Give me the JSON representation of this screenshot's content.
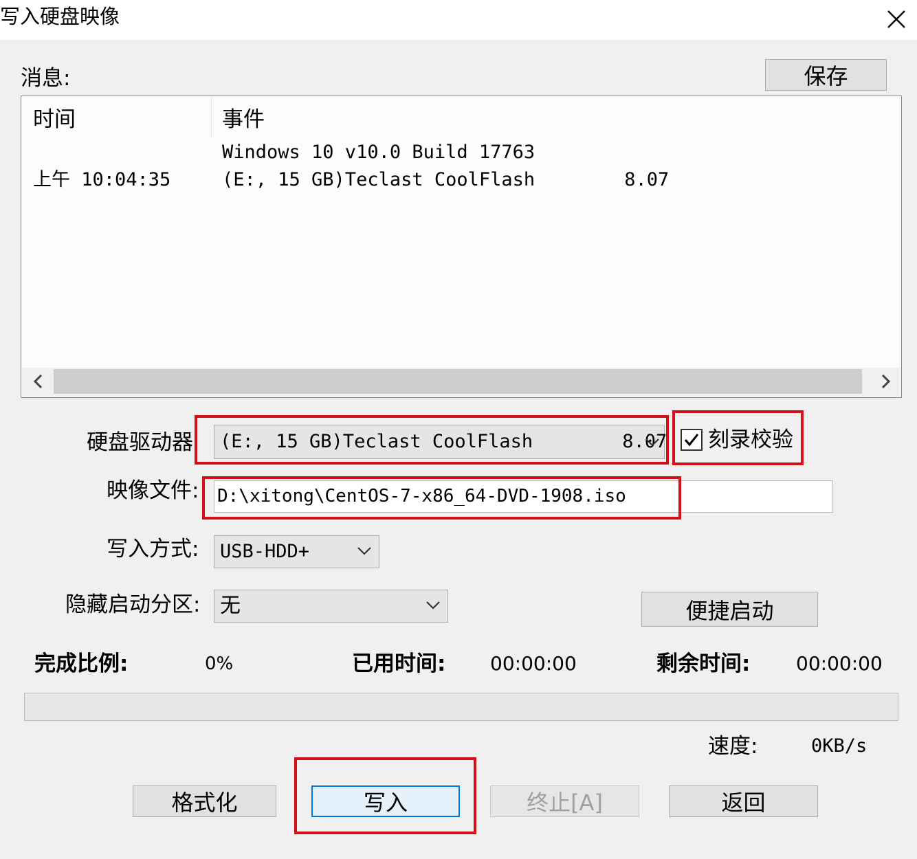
{
  "window": {
    "title": "写入硬盘映像",
    "close_icon": "close-icon"
  },
  "messages": {
    "label": "消息:",
    "save_button": "保存",
    "columns": [
      "时间",
      "事件"
    ],
    "rows": [
      {
        "time": "",
        "event": "Windows 10 v10.0 Build 17763"
      },
      {
        "time": "上午 10:04:35",
        "event": "(E:, 15 GB)Teclast CoolFlash        8.07"
      }
    ]
  },
  "drive": {
    "label": "硬盘驱动器",
    "selected": "(E:, 15 GB)Teclast CoolFlash        8.07",
    "verify_label": "刻录校验",
    "verify_checked": true
  },
  "image_file": {
    "label": "映像文件:",
    "value": "D:\\xitong\\CentOS-7-x86_64-DVD-1908.iso"
  },
  "write_mode": {
    "label": "写入方式:",
    "selected": "USB-HDD+"
  },
  "hidden_partition": {
    "label": "隐藏启动分区:",
    "selected": "无",
    "quick_boot_button": "便捷启动"
  },
  "progress": {
    "complete_label": "完成比例:",
    "complete_value": "0%",
    "complete_fraction": 0,
    "elapsed_label": "已用时间:",
    "elapsed_value": "00:00:00",
    "remaining_label": "剩余时间:",
    "remaining_value": "00:00:00",
    "speed_label": "速度:",
    "speed_value": "0KB/s"
  },
  "buttons": {
    "format": "格式化",
    "write": "写入",
    "stop": "终止[A]",
    "back": "返回"
  },
  "colors": {
    "highlight": "#d4101b",
    "accent": "#0078d7"
  }
}
